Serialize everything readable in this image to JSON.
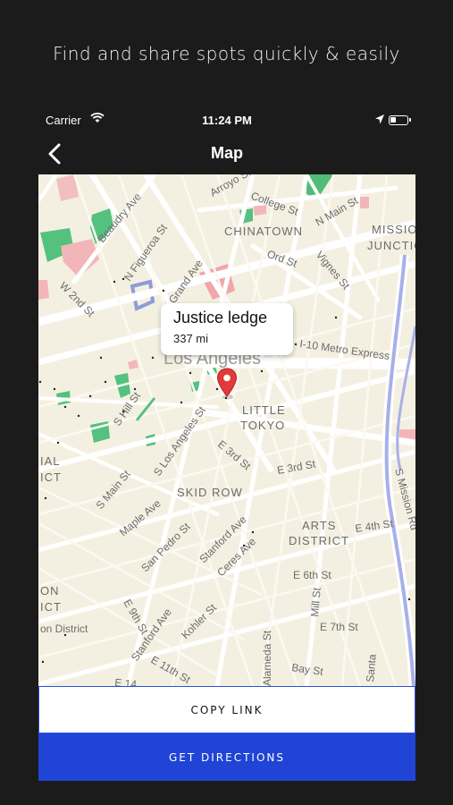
{
  "header": {
    "headline": "Find and share spots quickly & easily"
  },
  "status_bar": {
    "carrier": "Carrier",
    "time": "11:24 PM"
  },
  "nav": {
    "title": "Map",
    "back_icon": "chevron-left-icon"
  },
  "map": {
    "callout": {
      "name": "Justice ledge",
      "distance": "337 mi"
    },
    "pin_color": "#e23a3a",
    "labels": {
      "arroyo": "Arroyo St",
      "college": "College St",
      "n_main": "N Main St",
      "mission": "MISSIO",
      "junction": "JUNCTIO",
      "beaudry": "Beaudry Ave",
      "chinatown": "CHINATOWN",
      "ord": "Ord St",
      "n_figueroa": "N Figueroa St",
      "vignes": "Vignes St",
      "w_2nd": "W 2nd St",
      "n_grand": "N Grand Ave",
      "los_angeles": "Los Angeles",
      "i10": "I-10 Metro Express",
      "little": "LITTLE",
      "tokyo": "TOKYO",
      "s_hill": "S Hill St",
      "e_3rd_a": "E 3rd St",
      "e_3rd_b": "E 3rd St",
      "s_los_angeles": "S Los Angeles St",
      "ial": "IAL",
      "ict": "ICT",
      "s_main": "S Main St",
      "skid_row": "SKID ROW",
      "s_mission": "S Mission Rd",
      "maple": "Maple Ave",
      "arts": "ARTS",
      "district": "DISTRICT",
      "e_4th": "E 4th St",
      "san_pedro": "San Pedro St",
      "stanford_a": "Stanford Ave",
      "ceres": "Ceres Ave",
      "e_6th": "E 6th St",
      "on": "ON",
      "ict2": "ICT",
      "e_9th": "E 9th St",
      "mill": "Mill St",
      "e_7th": "E 7th St",
      "on_district": "on District",
      "stanford_b": "Stanford Ave",
      "kohler": "Kohler St",
      "e_11th": "E 11th St",
      "alameda": "Alameda St",
      "bay": "Bay St",
      "santa": "Santa",
      "e_14": "E 14"
    }
  },
  "actions": {
    "copy_link": "COPY LINK",
    "get_directions": "GET DIRECTIONS"
  }
}
